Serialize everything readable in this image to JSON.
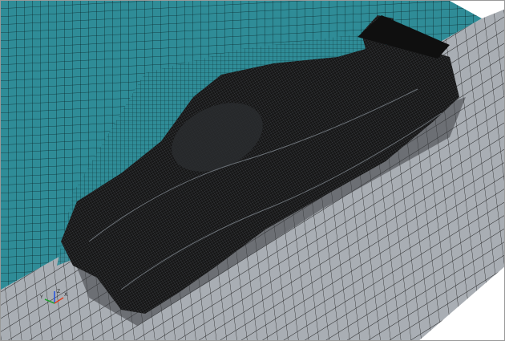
{
  "viewport": {
    "description_hidden": true,
    "colors": {
      "wall": "#2f8c97",
      "floor": "#a9aeb4",
      "mesh_line": "#0a0a0a",
      "background": "#ffffff",
      "axis_x": "#e04020",
      "axis_y": "#20a030",
      "axis_z": "#2050e0"
    }
  },
  "axis_triad": {
    "x_label": "X",
    "y_label": "Y",
    "z_label": "Z"
  }
}
